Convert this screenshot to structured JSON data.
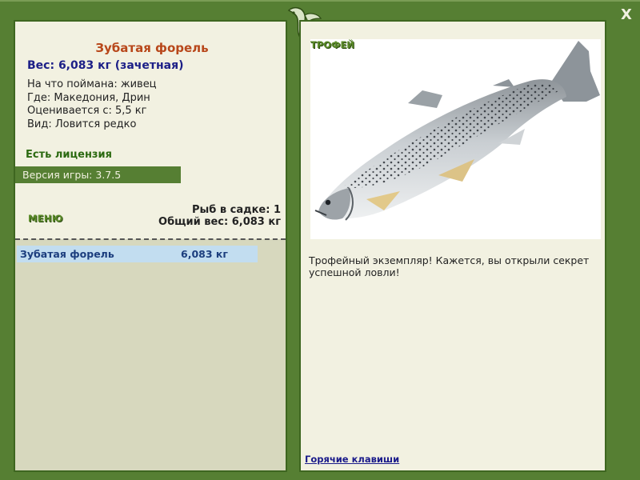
{
  "fish": {
    "title": "Зубатая форель",
    "weight_line": "Вес: 6,083 кг (зачетная)",
    "caught_with": "На что поймана: живец",
    "location": "Где: Македония, Дрин",
    "rated_from": "Оценивается с: 5,5 кг",
    "rarity": "Вид: Ловится редко"
  },
  "license": "Есть лицензия",
  "version": "Версия игры: 3.7.5",
  "menu_label": "МЕНЮ",
  "keep": {
    "count_line": "Рыб в садке: 1",
    "total_line": "Общий вес: 6,083 кг"
  },
  "catch_list": [
    {
      "name": "Зубатая форель",
      "weight": "6,083 кг"
    }
  ],
  "trophy": {
    "label": "ТРОФЕЙ",
    "text": "Трофейный экземпляр! Кажется, вы открыли секрет успешной ловли!"
  },
  "hotkeys_link": "Горячие клавиши",
  "close_label": "X",
  "icons": {
    "close": "close-icon",
    "logo": "fish-logo-icon"
  },
  "colors": {
    "frame": "#567f33",
    "panel": "#f2f1e1",
    "title": "#b8471a",
    "weight": "#1c1f87",
    "license": "#2c6a11",
    "selected_row": "#c2ddf0"
  }
}
